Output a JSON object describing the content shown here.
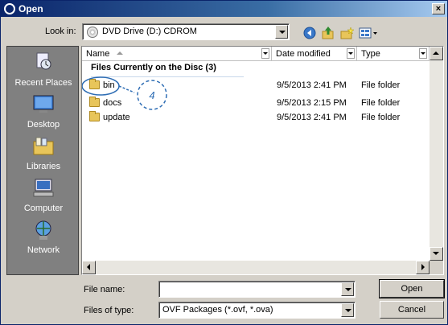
{
  "window": {
    "title": "Open"
  },
  "lookin": {
    "label": "Look in:",
    "value": "DVD Drive (D:) CDROM"
  },
  "toolbar": {
    "back": "back-icon",
    "up": "up-folder-icon",
    "new_folder": "new-folder-icon",
    "views": "views-menu-icon"
  },
  "places": [
    {
      "label": "Recent Places",
      "icon": "recent-places-icon"
    },
    {
      "label": "Desktop",
      "icon": "desktop-icon"
    },
    {
      "label": "Libraries",
      "icon": "libraries-icon"
    },
    {
      "label": "Computer",
      "icon": "computer-icon"
    },
    {
      "label": "Network",
      "icon": "network-icon"
    }
  ],
  "columns": [
    "Name",
    "Date modified",
    "Type"
  ],
  "group": {
    "label": "Files Currently on the Disc (3)"
  },
  "rows": [
    {
      "name": "bin",
      "date": "9/5/2013 2:41 PM",
      "type": "File folder"
    },
    {
      "name": "docs",
      "date": "9/5/2013 2:15 PM",
      "type": "File folder"
    },
    {
      "name": "update",
      "date": "9/5/2013 2:41 PM",
      "type": "File folder"
    }
  ],
  "callout": {
    "number": "4"
  },
  "filename": {
    "label": "File name:",
    "value": ""
  },
  "filetype": {
    "label": "Files of type:",
    "value": "OVF Packages (*.ovf, *.ova)"
  },
  "buttons": {
    "open": "Open",
    "cancel": "Cancel"
  },
  "colors": {
    "title_start": "#0a246a",
    "places_bg": "#808080",
    "callout": "#2e6db4"
  }
}
